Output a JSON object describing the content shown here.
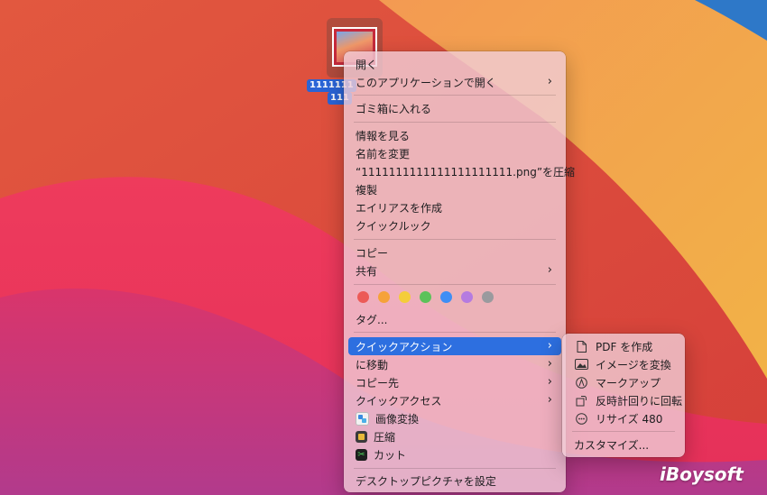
{
  "desktop": {
    "file": {
      "name_line1": "1111111",
      "name_line2": "111"
    },
    "watermark": "iBoysoft"
  },
  "context_menu": {
    "open": "開く",
    "open_with": "このアプリケーションで開く",
    "move_to_trash": "ゴミ箱に入れる",
    "get_info": "情報を見る",
    "rename": "名前を変更",
    "compress": "“1111111111111111111111.png”を圧縮",
    "duplicate": "複製",
    "make_alias": "エイリアスを作成",
    "quick_look": "クイックルック",
    "copy": "コピー",
    "share": "共有",
    "tag_colors": [
      "#ec5a57",
      "#f5a23a",
      "#f4cd3a",
      "#5cc25a",
      "#3e8ef5",
      "#b57be0",
      "#9a9a9e"
    ],
    "tags": "タグ...",
    "quick_actions": "クイックアクション",
    "move_to": "に移動",
    "copy_to": "コピー先",
    "quick_access": "クイックアクセス",
    "image_convert": "画像変換",
    "compress_app": "圧縮",
    "cut": "カット",
    "set_desktop_picture": "デスクトップピクチャを設定"
  },
  "submenu": {
    "create_pdf": "PDF を作成",
    "convert_image": "イメージを変換",
    "markup": "マークアップ",
    "rotate_left": "反時計回りに回転",
    "resize": "リサイズ 480",
    "customize": "カスタマイズ..."
  },
  "colors": {
    "highlight": "#2d6fe0",
    "selection": "#2a64d6"
  }
}
